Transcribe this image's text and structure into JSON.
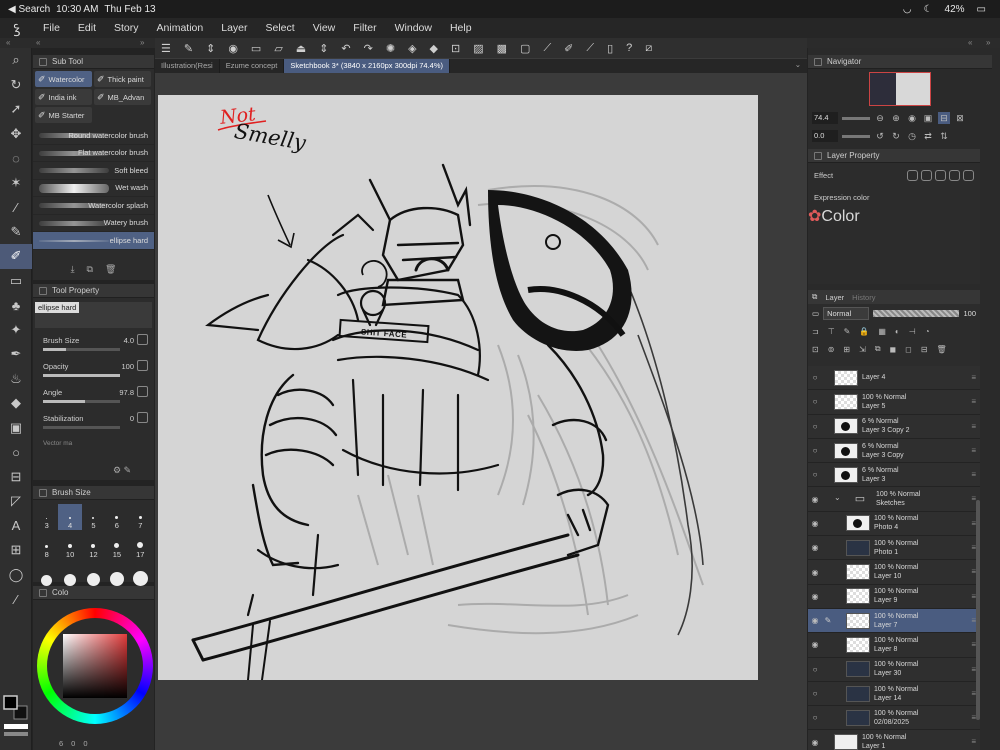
{
  "status": {
    "back": "◀ Search",
    "time": "10:30 AM",
    "date": "Thu Feb 13",
    "battery": "42%"
  },
  "menu": [
    "File",
    "Edit",
    "Story",
    "Animation",
    "Layer",
    "Select",
    "View",
    "Filter",
    "Window",
    "Help"
  ],
  "subtool": {
    "title": "Sub Tool",
    "tabs": [
      "Watercolor",
      "Thick paint",
      "India ink",
      "MB_Advan",
      "MB Starter"
    ],
    "brushes": [
      "Round watercolor brush",
      "Flat watercolor brush",
      "Soft bleed",
      "Wet wash",
      "Watercolor splash",
      "Watery brush",
      "ellipse hard"
    ],
    "active_brush": "ellipse hard"
  },
  "tool_property": {
    "title": "Tool Property",
    "name": "ellipse hard",
    "rows": [
      {
        "label": "Brush Size",
        "value": "4.0",
        "fill": 0.3
      },
      {
        "label": "Opacity",
        "value": "100",
        "fill": 1.0
      },
      {
        "label": "Angle",
        "value": "97.8",
        "fill": 0.55
      },
      {
        "label": "Stabilization",
        "value": "0",
        "fill": 0.0
      }
    ],
    "vector": "Vector ma"
  },
  "brush_size": {
    "title": "Brush Size",
    "sizes": [
      "3",
      "4",
      "5",
      "6",
      "7",
      "8",
      "10",
      "12",
      "15",
      "17",
      "",
      "",
      "",
      "",
      ""
    ],
    "active": "4"
  },
  "color": {
    "tab": "Colo",
    "footer": [
      "6",
      "0",
      "0"
    ],
    "hue": "#e23b3b"
  },
  "canvas": {
    "tabs": [
      "Illustration(Resi",
      "Ezume concept",
      "Sketchbook 3* (3840 x 2160px 300dpi 74.4%)"
    ],
    "active_tab": "Sketchbook 3* (3840 x 2160px 300dpi 74.4%)",
    "annotation_red": "Not",
    "annotation_black": "Smelly",
    "shield_text": "SHIT FACE"
  },
  "navigator": {
    "title": "Navigator",
    "zoom": "74.4",
    "rotate": "0.0"
  },
  "layer_property": {
    "title": "Layer Property",
    "effect": "Effect",
    "expression_label": "Expression color",
    "expression_value": "Color"
  },
  "layer_panel": {
    "tab": "Layer",
    "tab2": "History",
    "blend": "Normal",
    "opacity": "100",
    "layers": [
      {
        "pct": "",
        "name": "Layer 4",
        "thumb": "checker",
        "vis": false,
        "indent": false
      },
      {
        "pct": "100 %  Normal",
        "name": "Layer 5",
        "thumb": "checker",
        "vis": false,
        "indent": false
      },
      {
        "pct": "6 %  Normal",
        "name": "Layer 3 Copy 2",
        "thumb": "dotthumb",
        "vis": false,
        "indent": false
      },
      {
        "pct": "6 %  Normal",
        "name": "Layer 3 Copy",
        "thumb": "dotthumb",
        "vis": false,
        "indent": false
      },
      {
        "pct": "6 %  Normal",
        "name": "Layer 3",
        "thumb": "dotthumb",
        "vis": false,
        "indent": false
      },
      {
        "pct": "100 %  Normal",
        "name": "Sketches",
        "thumb": "folder",
        "vis": true,
        "indent": false
      },
      {
        "pct": "100 %  Normal",
        "name": "Photo 4",
        "thumb": "dotthumb",
        "vis": true,
        "indent": true
      },
      {
        "pct": "100 %  Normal",
        "name": "Photo 1",
        "thumb": "dark",
        "vis": true,
        "indent": true
      },
      {
        "pct": "100 %  Normal",
        "name": "Layer 10",
        "thumb": "checker",
        "vis": true,
        "indent": true
      },
      {
        "pct": "100 %  Normal",
        "name": "Layer 9",
        "thumb": "checker",
        "vis": true,
        "indent": true
      },
      {
        "pct": "100 %  Normal",
        "name": "Layer 7",
        "thumb": "checker",
        "vis": true,
        "indent": true,
        "active": true
      },
      {
        "pct": "100 %  Normal",
        "name": "Layer 8",
        "thumb": "checker",
        "vis": true,
        "indent": true
      },
      {
        "pct": "100 %  Normal",
        "name": "Layer 30",
        "thumb": "dark",
        "vis": false,
        "indent": true
      },
      {
        "pct": "100 %  Normal",
        "name": "Layer 14",
        "thumb": "dark",
        "vis": false,
        "indent": true
      },
      {
        "pct": "100 %  Normal",
        "name": "02/08/2025",
        "thumb": "dark",
        "vis": false,
        "indent": true
      },
      {
        "pct": "100 %  Normal",
        "name": "Layer 1",
        "thumb": "plain",
        "vis": true,
        "indent": false
      }
    ]
  }
}
